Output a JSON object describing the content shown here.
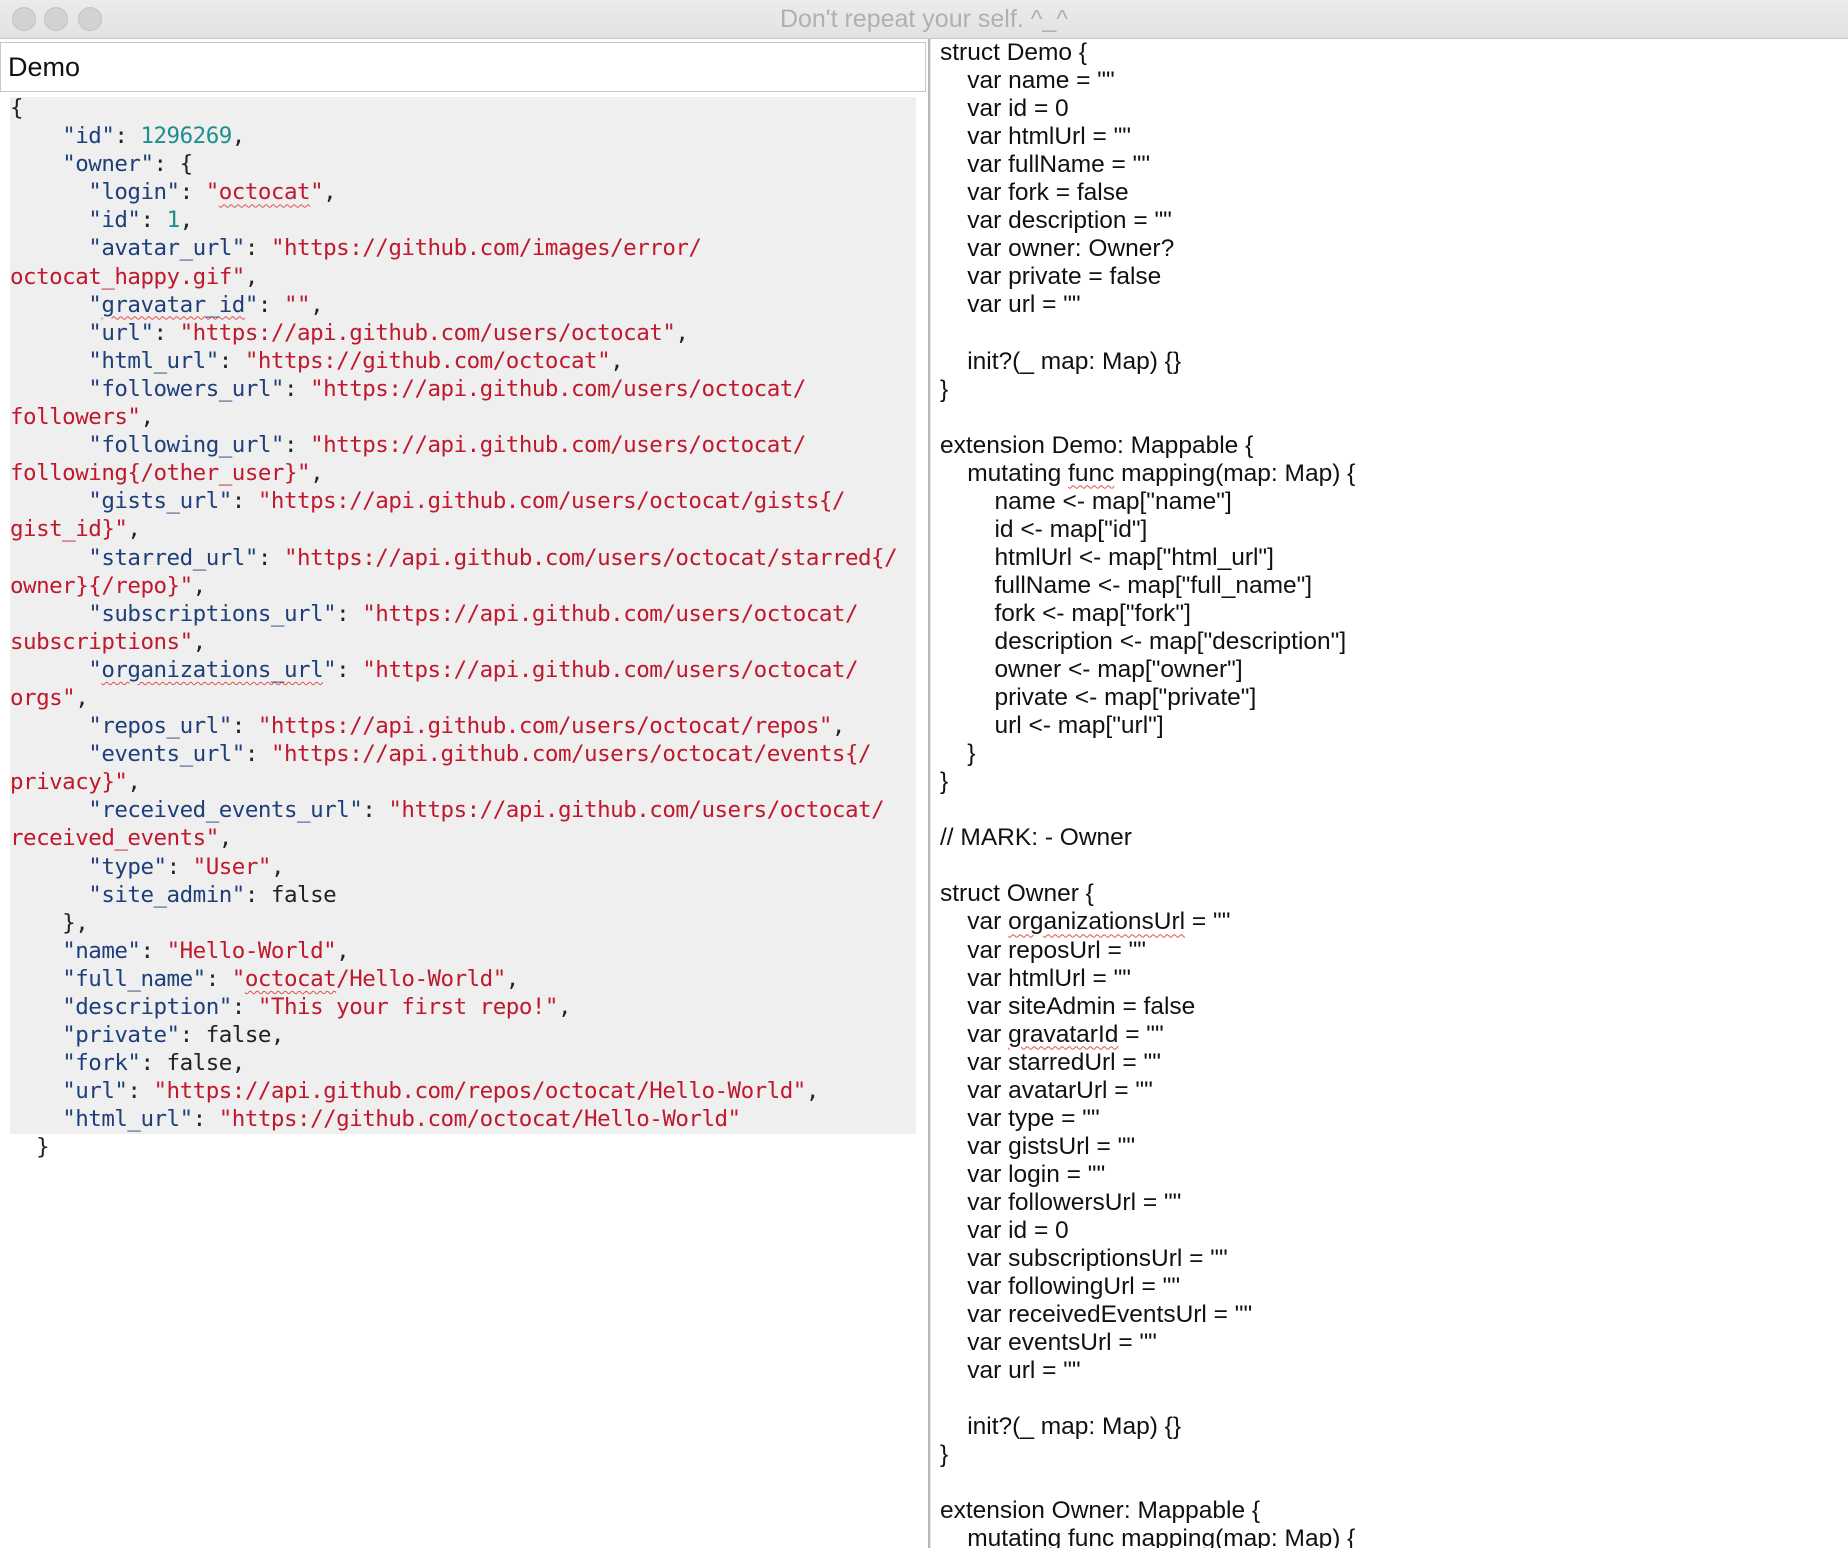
{
  "window": {
    "title": "Don't repeat your self. ^_^"
  },
  "name_field": {
    "value": "Demo"
  },
  "json_input": [
    [
      [
        "p",
        "{"
      ]
    ],
    [
      [
        "p",
        "    "
      ],
      [
        "k",
        "\"id\""
      ],
      [
        "p",
        ": "
      ],
      [
        "n",
        "1296269"
      ],
      [
        "p",
        ","
      ]
    ],
    [
      [
        "p",
        "    "
      ],
      [
        "k",
        "\"owner\""
      ],
      [
        "p",
        ": {"
      ]
    ],
    [
      [
        "p",
        "      "
      ],
      [
        "k",
        "\"login\""
      ],
      [
        "p",
        ": "
      ],
      [
        "s",
        "\""
      ],
      [
        "ss",
        "octocat"
      ],
      [
        "s",
        "\""
      ],
      [
        "p",
        ","
      ]
    ],
    [
      [
        "p",
        "      "
      ],
      [
        "k",
        "\"id\""
      ],
      [
        "p",
        ": "
      ],
      [
        "n",
        "1"
      ],
      [
        "p",
        ","
      ]
    ],
    [
      [
        "p",
        "      "
      ],
      [
        "k",
        "\"avatar_url\""
      ],
      [
        "p",
        ": "
      ],
      [
        "s",
        "\"https://github.com/images/error/"
      ]
    ],
    [
      [
        "s",
        "octocat_happy.gif\""
      ],
      [
        "p",
        ","
      ]
    ],
    [
      [
        "p",
        "      "
      ],
      [
        "k",
        "\""
      ],
      [
        "ks",
        "gravatar_id"
      ],
      [
        "k",
        "\""
      ],
      [
        "p",
        ": "
      ],
      [
        "s",
        "\"\""
      ],
      [
        "p",
        ","
      ]
    ],
    [
      [
        "p",
        "      "
      ],
      [
        "k",
        "\"url\""
      ],
      [
        "p",
        ": "
      ],
      [
        "s",
        "\"https://api.github.com/users/octocat\""
      ],
      [
        "p",
        ","
      ]
    ],
    [
      [
        "p",
        "      "
      ],
      [
        "k",
        "\"html_url\""
      ],
      [
        "p",
        ": "
      ],
      [
        "s",
        "\"https://github.com/octocat\""
      ],
      [
        "p",
        ","
      ]
    ],
    [
      [
        "p",
        "      "
      ],
      [
        "k",
        "\"followers_url\""
      ],
      [
        "p",
        ": "
      ],
      [
        "s",
        "\"https://api.github.com/users/octocat/"
      ]
    ],
    [
      [
        "s",
        "followers\""
      ],
      [
        "p",
        ","
      ]
    ],
    [
      [
        "p",
        "      "
      ],
      [
        "k",
        "\"following_url\""
      ],
      [
        "p",
        ": "
      ],
      [
        "s",
        "\"https://api.github.com/users/octocat/"
      ]
    ],
    [
      [
        "s",
        "following{/other_user}\""
      ],
      [
        "p",
        ","
      ]
    ],
    [
      [
        "p",
        "      "
      ],
      [
        "k",
        "\"gists_url\""
      ],
      [
        "p",
        ": "
      ],
      [
        "s",
        "\"https://api.github.com/users/octocat/gists{/"
      ]
    ],
    [
      [
        "s",
        "gist_id}\""
      ],
      [
        "p",
        ","
      ]
    ],
    [
      [
        "p",
        "      "
      ],
      [
        "k",
        "\"starred_url\""
      ],
      [
        "p",
        ": "
      ],
      [
        "s",
        "\"https://api.github.com/users/octocat/starred{/"
      ]
    ],
    [
      [
        "s",
        "owner}{/repo}\""
      ],
      [
        "p",
        ","
      ]
    ],
    [
      [
        "p",
        "      "
      ],
      [
        "k",
        "\"subscriptions_url\""
      ],
      [
        "p",
        ": "
      ],
      [
        "s",
        "\"https://api.github.com/users/octocat/"
      ]
    ],
    [
      [
        "s",
        "subscriptions\""
      ],
      [
        "p",
        ","
      ]
    ],
    [
      [
        "p",
        "      "
      ],
      [
        "k",
        "\""
      ],
      [
        "ks",
        "organizations_url"
      ],
      [
        "k",
        "\""
      ],
      [
        "p",
        ": "
      ],
      [
        "s",
        "\"https://api.github.com/users/octocat/"
      ]
    ],
    [
      [
        "s",
        "orgs\""
      ],
      [
        "p",
        ","
      ]
    ],
    [
      [
        "p",
        "      "
      ],
      [
        "k",
        "\"repos_url\""
      ],
      [
        "p",
        ": "
      ],
      [
        "s",
        "\"https://api.github.com/users/octocat/repos\""
      ],
      [
        "p",
        ","
      ]
    ],
    [
      [
        "p",
        "      "
      ],
      [
        "k",
        "\"events_url\""
      ],
      [
        "p",
        ": "
      ],
      [
        "s",
        "\"https://api.github.com/users/octocat/events{/"
      ]
    ],
    [
      [
        "s",
        "privacy}\""
      ],
      [
        "p",
        ","
      ]
    ],
    [
      [
        "p",
        "      "
      ],
      [
        "k",
        "\"received_events_url\""
      ],
      [
        "p",
        ": "
      ],
      [
        "s",
        "\"https://api.github.com/users/octocat/"
      ]
    ],
    [
      [
        "s",
        "received_events\""
      ],
      [
        "p",
        ","
      ]
    ],
    [
      [
        "p",
        "      "
      ],
      [
        "k",
        "\"type\""
      ],
      [
        "p",
        ": "
      ],
      [
        "s",
        "\"User\""
      ],
      [
        "p",
        ","
      ]
    ],
    [
      [
        "p",
        "      "
      ],
      [
        "k",
        "\"site_admin\""
      ],
      [
        "p",
        ": false"
      ]
    ],
    [
      [
        "p",
        "    },"
      ]
    ],
    [
      [
        "p",
        "    "
      ],
      [
        "k",
        "\"name\""
      ],
      [
        "p",
        ": "
      ],
      [
        "s",
        "\"Hello-World\""
      ],
      [
        "p",
        ","
      ]
    ],
    [
      [
        "p",
        "    "
      ],
      [
        "k",
        "\"full_name\""
      ],
      [
        "p",
        ": "
      ],
      [
        "s",
        "\""
      ],
      [
        "ss",
        "octocat"
      ],
      [
        "s",
        "/Hello-World\""
      ],
      [
        "p",
        ","
      ]
    ],
    [
      [
        "p",
        "    "
      ],
      [
        "k",
        "\"description\""
      ],
      [
        "p",
        ": "
      ],
      [
        "s",
        "\"This your first repo!\""
      ],
      [
        "p",
        ","
      ]
    ],
    [
      [
        "p",
        "    "
      ],
      [
        "k",
        "\"private\""
      ],
      [
        "p",
        ": false,"
      ]
    ],
    [
      [
        "p",
        "    "
      ],
      [
        "k",
        "\"fork\""
      ],
      [
        "p",
        ": false,"
      ]
    ],
    [
      [
        "p",
        "    "
      ],
      [
        "k",
        "\"url\""
      ],
      [
        "p",
        ": "
      ],
      [
        "s",
        "\"https://api.github.com/repos/octocat/Hello-World\""
      ],
      [
        "p",
        ","
      ]
    ],
    [
      [
        "p",
        "    "
      ],
      [
        "k",
        "\"html_url\""
      ],
      [
        "p",
        ": "
      ],
      [
        "s",
        "\"https://github.com/octocat/Hello-World\""
      ]
    ],
    [
      [
        "p",
        "  }"
      ]
    ]
  ],
  "generated_code": [
    [
      [
        "t",
        "struct Demo {"
      ]
    ],
    [
      [
        "t",
        "    var name = \"\""
      ]
    ],
    [
      [
        "t",
        "    var id = 0"
      ]
    ],
    [
      [
        "t",
        "    var htmlUrl = \"\""
      ]
    ],
    [
      [
        "t",
        "    var fullName = \"\""
      ]
    ],
    [
      [
        "t",
        "    var fork = false"
      ]
    ],
    [
      [
        "t",
        "    var description = \"\""
      ]
    ],
    [
      [
        "t",
        "    var owner: Owner?"
      ]
    ],
    [
      [
        "t",
        "    var private = false"
      ]
    ],
    [
      [
        "t",
        "    var url = \"\""
      ]
    ],
    [
      [
        "t",
        ""
      ]
    ],
    [
      [
        "t",
        "    init?(_ map: Map) {}"
      ]
    ],
    [
      [
        "t",
        "}"
      ]
    ],
    [
      [
        "t",
        ""
      ]
    ],
    [
      [
        "t",
        "extension Demo: Mappable {"
      ]
    ],
    [
      [
        "t",
        "    mutating "
      ],
      [
        "ts",
        "func"
      ],
      [
        "t",
        " mapping(map: Map) {"
      ]
    ],
    [
      [
        "t",
        "        name <- map[\"name\"]"
      ]
    ],
    [
      [
        "t",
        "        id <- map[\"id\"]"
      ]
    ],
    [
      [
        "t",
        "        htmlUrl <- map[\"html_url\"]"
      ]
    ],
    [
      [
        "t",
        "        fullName <- map[\"full_name\"]"
      ]
    ],
    [
      [
        "t",
        "        fork <- map[\"fork\"]"
      ]
    ],
    [
      [
        "t",
        "        description <- map[\"description\"]"
      ]
    ],
    [
      [
        "t",
        "        owner <- map[\"owner\"]"
      ]
    ],
    [
      [
        "t",
        "        private <- map[\"private\"]"
      ]
    ],
    [
      [
        "t",
        "        url <- map[\"url\"]"
      ]
    ],
    [
      [
        "t",
        "    }"
      ]
    ],
    [
      [
        "t",
        "}"
      ]
    ],
    [
      [
        "t",
        ""
      ]
    ],
    [
      [
        "t",
        "// MARK: - Owner"
      ]
    ],
    [
      [
        "t",
        ""
      ]
    ],
    [
      [
        "t",
        "struct Owner {"
      ]
    ],
    [
      [
        "t",
        "    var "
      ],
      [
        "ts",
        "organizationsUrl"
      ],
      [
        "t",
        " = \"\""
      ]
    ],
    [
      [
        "t",
        "    var reposUrl = \"\""
      ]
    ],
    [
      [
        "t",
        "    var htmlUrl = \"\""
      ]
    ],
    [
      [
        "t",
        "    var siteAdmin = false"
      ]
    ],
    [
      [
        "t",
        "    var "
      ],
      [
        "ts",
        "gravatarId"
      ],
      [
        "t",
        " = \"\""
      ]
    ],
    [
      [
        "t",
        "    var starredUrl = \"\""
      ]
    ],
    [
      [
        "t",
        "    var avatarUrl = \"\""
      ]
    ],
    [
      [
        "t",
        "    var type = \"\""
      ]
    ],
    [
      [
        "t",
        "    var gistsUrl = \"\""
      ]
    ],
    [
      [
        "t",
        "    var login = \"\""
      ]
    ],
    [
      [
        "t",
        "    var followersUrl = \"\""
      ]
    ],
    [
      [
        "t",
        "    var id = 0"
      ]
    ],
    [
      [
        "t",
        "    var subscriptionsUrl = \"\""
      ]
    ],
    [
      [
        "t",
        "    var followingUrl = \"\""
      ]
    ],
    [
      [
        "t",
        "    var receivedEventsUrl = \"\""
      ]
    ],
    [
      [
        "t",
        "    var eventsUrl = \"\""
      ]
    ],
    [
      [
        "t",
        "    var url = \"\""
      ]
    ],
    [
      [
        "t",
        ""
      ]
    ],
    [
      [
        "t",
        "    init?(_ map: Map) {}"
      ]
    ],
    [
      [
        "t",
        "}"
      ]
    ],
    [
      [
        "t",
        ""
      ]
    ],
    [
      [
        "t",
        "extension Owner: Mappable {"
      ]
    ],
    [
      [
        "t",
        "    mutating func mapping(map: Map) {"
      ]
    ]
  ]
}
